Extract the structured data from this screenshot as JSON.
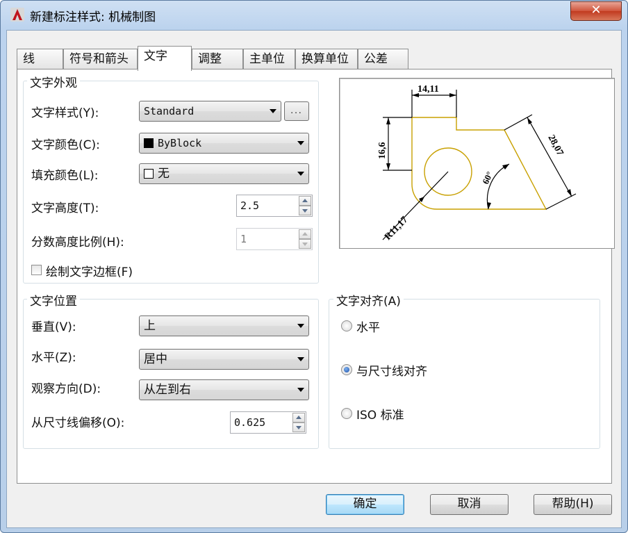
{
  "window": {
    "title": "新建标注样式: 机械制图",
    "close_symbol": "✕"
  },
  "tabs": [
    {
      "label": "线"
    },
    {
      "label": "符号和箭头"
    },
    {
      "label": "文字",
      "active": true
    },
    {
      "label": "调整"
    },
    {
      "label": "主单位"
    },
    {
      "label": "换算单位"
    },
    {
      "label": "公差"
    }
  ],
  "appearance": {
    "title": "文字外观",
    "style_label": "文字样式(Y):",
    "style_value": "Standard",
    "style_button": "...",
    "color_label": "文字颜色(C):",
    "color_value": "ByBlock",
    "fill_label": "填充颜色(L):",
    "fill_value": "无",
    "height_label": "文字高度(T):",
    "height_value": "2.5",
    "fraction_label": "分数高度比例(H):",
    "fraction_value": "1",
    "frame_label": "绘制文字边框(F)",
    "frame_checked": false
  },
  "placement": {
    "title": "文字位置",
    "vertical_label": "垂直(V):",
    "vertical_value": "上",
    "horizontal_label": "水平(Z):",
    "horizontal_value": "居中",
    "view_label": "观察方向(D):",
    "view_value": "从左到右",
    "offset_label": "从尺寸线偏移(O):",
    "offset_value": "0.625"
  },
  "alignment": {
    "title": "文字对齐(A)",
    "options": [
      {
        "label": "水平",
        "checked": false
      },
      {
        "label": "与尺寸线对齐",
        "checked": true
      },
      {
        "label": "ISO 标准",
        "checked": false
      }
    ]
  },
  "preview": {
    "dim_top": "14,11",
    "dim_left": "16,6",
    "dim_right": "28,07",
    "dim_angle": "60°",
    "dim_radius": "R11,17",
    "line_color": "#c8a000"
  },
  "buttons": {
    "ok": "确定",
    "cancel": "取消",
    "help": "帮助(H)"
  },
  "colors": {
    "accent": "#3c7fb1",
    "close": "#c13a1f"
  }
}
